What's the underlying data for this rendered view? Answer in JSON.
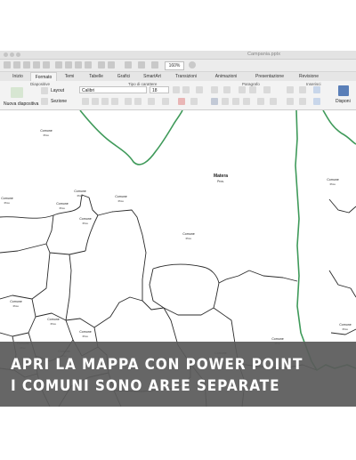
{
  "window": {
    "document_title": "Campania.pptx"
  },
  "toolbar": {
    "zoom_value": "160%"
  },
  "tabs": [
    "Inizio",
    "Formato",
    "Temi",
    "Tabelle",
    "Grafici",
    "SmartArt",
    "Transizioni",
    "Animazioni",
    "Presentazione",
    "Revisione"
  ],
  "ribbon": {
    "groups": [
      "Diapositive",
      "Tipo di carattere",
      "Paragrafo",
      "Inserisci"
    ],
    "new_slide_label": "Nuova diapositiva",
    "layout_label": "Layout",
    "section_label": "Sezione",
    "font_name": "Calibri",
    "font_size": "18",
    "arrange_label": "Disponi"
  },
  "map": {
    "towns": [
      {
        "name": "Matera",
        "sub": "Prov."
      },
      {
        "name": "Comune",
        "sub": "Prov."
      },
      {
        "name": "Comune",
        "sub": "Prov."
      },
      {
        "name": "Comune",
        "sub": "Prov."
      },
      {
        "name": "Comune",
        "sub": "Prov."
      },
      {
        "name": "Comune",
        "sub": "Prov."
      },
      {
        "name": "Comune",
        "sub": "Prov."
      },
      {
        "name": "Comune",
        "sub": "Prov."
      },
      {
        "name": "Comune",
        "sub": "Prov."
      },
      {
        "name": "Comune",
        "sub": "Prov."
      },
      {
        "name": "Comune",
        "sub": "Prov."
      },
      {
        "name": "Comune",
        "sub": "Prov."
      },
      {
        "name": "Comune",
        "sub": "Prov."
      },
      {
        "name": "Comune",
        "sub": "Prov."
      },
      {
        "name": "Comune",
        "sub": "Prov."
      },
      {
        "name": "Comune",
        "sub": "Prov."
      },
      {
        "name": "Comune",
        "sub": "Prov."
      },
      {
        "name": "Comune",
        "sub": "Prov."
      }
    ]
  },
  "banner": {
    "line1": "APRI LA MAPPA CON POWER POINT",
    "line2": "I COMUNI SONO AREE SEPARATE"
  },
  "colors": {
    "region_border": "#3f9a5a",
    "municipal_border": "#2a2a2a",
    "overlay": "#5a5a5a"
  }
}
